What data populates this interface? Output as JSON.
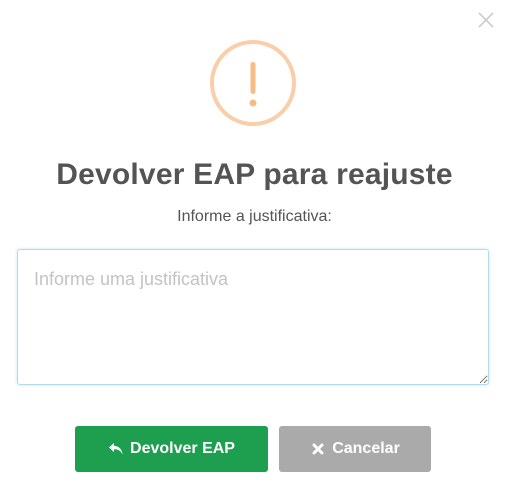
{
  "dialog": {
    "title": "Devolver EAP para reajuste",
    "subtitle": "Informe a justificativa:",
    "icon": "exclamation-warning-icon",
    "warning_color": "#f8bb86",
    "close_icon": "close-icon"
  },
  "justification": {
    "value": "",
    "placeholder": "Informe uma justificativa"
  },
  "buttons": {
    "confirm": {
      "label": "Devolver EAP",
      "icon": "reply-arrow-icon",
      "color": "#1e9e4f"
    },
    "cancel": {
      "label": "Cancelar",
      "icon": "x-icon",
      "color": "#aaaaaa"
    }
  }
}
